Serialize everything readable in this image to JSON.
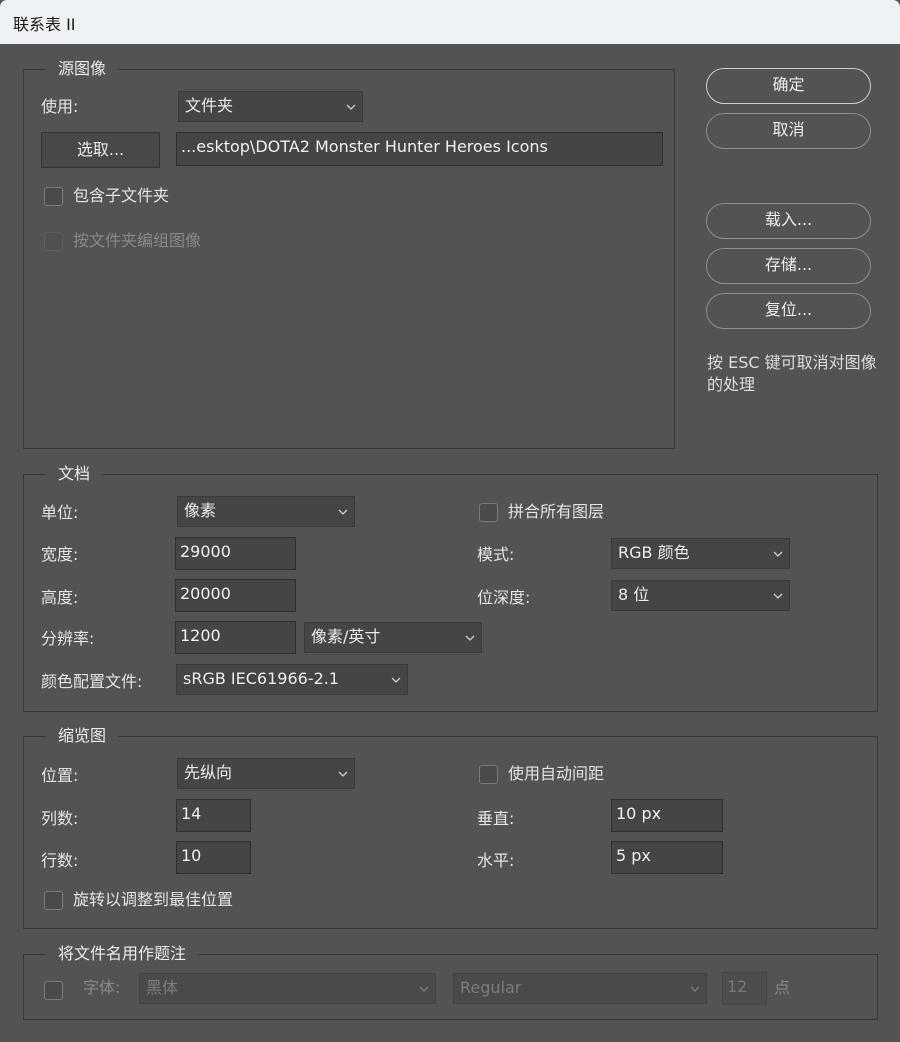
{
  "window": {
    "title": "联系表 II"
  },
  "buttons": {
    "ok": "确定",
    "cancel": "取消",
    "load": "载入...",
    "save": "存储...",
    "reset": "复位..."
  },
  "hint": "按 ESC 键可取消对图像的处理",
  "source": {
    "legend": "源图像",
    "use_label": "使用:",
    "use_value": "文件夹",
    "choose_button": "选取...",
    "path": "...esktop\\DOTA2 Monster Hunter Heroes Icons",
    "include_subfolders": "包含子文件夹",
    "group_by_folder": "按文件夹编组图像"
  },
  "document": {
    "legend": "文档",
    "units_label": "单位:",
    "units_value": "像素",
    "width_label": "宽度:",
    "width_value": "29000",
    "height_label": "高度:",
    "height_value": "20000",
    "resolution_label": "分辨率:",
    "resolution_value": "1200",
    "resolution_unit": "像素/英寸",
    "profile_label": "颜色配置文件:",
    "profile_value": "sRGB IEC61966-2.1",
    "flatten_label": "拼合所有图层",
    "mode_label": "模式:",
    "mode_value": "RGB 颜色",
    "depth_label": "位深度:",
    "depth_value": "8 位"
  },
  "thumbnails": {
    "legend": "缩览图",
    "place_label": "位置:",
    "place_value": "先纵向",
    "columns_label": "列数:",
    "columns_value": "14",
    "rows_label": "行数:",
    "rows_value": "10",
    "rotate_label": "旋转以调整到最佳位置",
    "auto_spacing_label": "使用自动间距",
    "vertical_label": "垂直:",
    "vertical_value": "10 px",
    "horizontal_label": "水平:",
    "horizontal_value": "5 px"
  },
  "caption": {
    "legend": "将文件名用作题注",
    "font_label": "字体:",
    "font_value": "黑体",
    "style_value": "Regular",
    "size_value": "12",
    "size_unit": "点"
  },
  "colors": {
    "background": "#535353",
    "field": "#454545",
    "titlebar": "#eef2f4"
  }
}
